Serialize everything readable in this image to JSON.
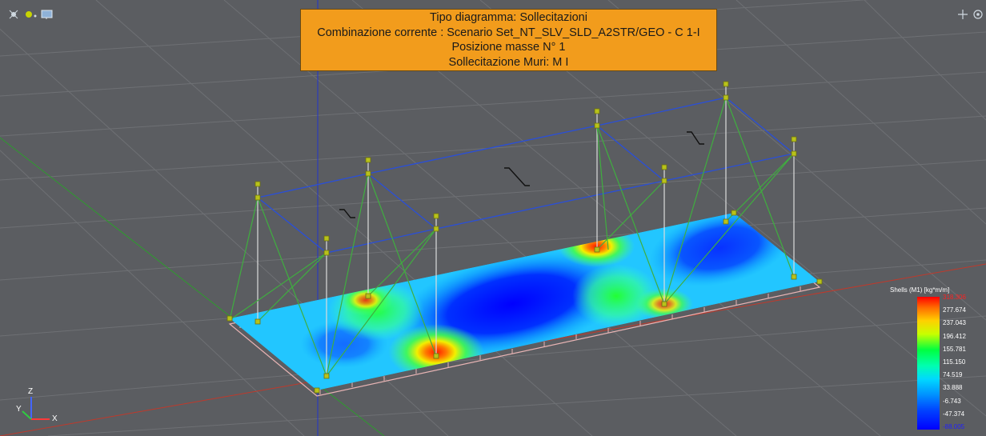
{
  "info": {
    "lines": [
      "Tipo diagramma: Sollecitazioni",
      "Combinazione corrente : Scenario Set_NT_SLV_SLD_A2STR/GEO - C 1-I",
      "Posizione masse N° 1",
      "Sollecitazione Muri: M I"
    ]
  },
  "legend": {
    "title": "Shells (M1) [kg*m/m]",
    "values": [
      "318.306",
      "277.674",
      "237.043",
      "196.412",
      "155.781",
      "115.150",
      "74.519",
      "33.888",
      "-6.743",
      "-47.374",
      "-88.005"
    ],
    "max_color": "#ff2020",
    "min_color": "#2020ff",
    "mid_color": "#ffffff"
  },
  "axes": {
    "x": "X",
    "y": "Y",
    "z": "Z"
  },
  "icons": {
    "top_left": [
      "select-icon",
      "light-icon",
      "monitor-icon"
    ],
    "top_right": [
      "move-icon",
      "rotate-icon"
    ]
  },
  "colors": {
    "background": "#5b5d61",
    "grid": "#6e7074",
    "frame_blue": "#2a4fd8",
    "brace_green": "#3fae3f",
    "node": "#b8c21a",
    "post": "#d8d8d8",
    "info_box": "#f29c1c",
    "axis_red": "#c0392b",
    "axis_green": "#2e9b2e",
    "axis_blue": "#2233cc"
  }
}
